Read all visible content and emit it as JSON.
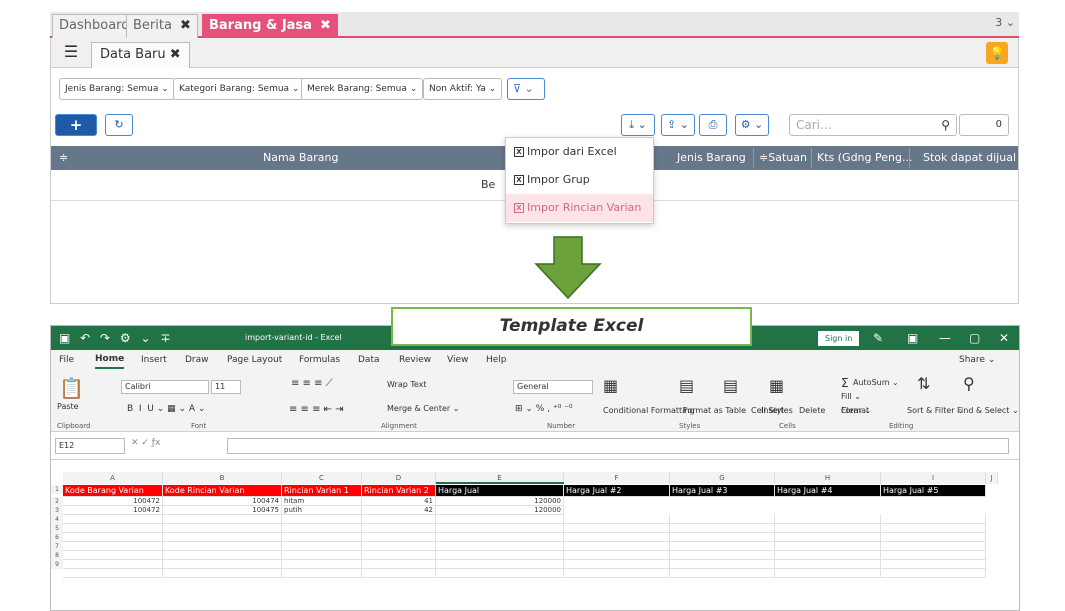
{
  "tabs": [
    {
      "label": "Dashboard"
    },
    {
      "label": "Berita",
      "close": "✖"
    },
    {
      "label": "Barang & Jasa",
      "close": "✖"
    }
  ],
  "tab_count": "3 ⌄",
  "subtab": {
    "label": "Data Baru",
    "close": "✖"
  },
  "filters": [
    "Jenis Barang: Semua ⌄",
    "Kategori Barang: Semua ⌄",
    "Merek Barang: Semua ⌄",
    "Non Aktif: Ya ⌄"
  ],
  "search_placeholder": "Cari...",
  "result_count": "0",
  "table_headers": [
    "Nama Barang",
    "Jenis Barang",
    "≑Satuan",
    "Kts (Gdng Peng...",
    "Stok dapat dijual"
  ],
  "empty_text": "Be",
  "dropdown": [
    {
      "label": "Impor dari Excel"
    },
    {
      "label": "Impor Grup"
    },
    {
      "label": "Impor Rincian Varian"
    }
  ],
  "template_label": "Template Excel",
  "excel": {
    "filename": "import-variant-id - Excel",
    "signin": "Sign in",
    "menu": [
      "File",
      "Home",
      "Insert",
      "Draw",
      "Page Layout",
      "Formulas",
      "Data",
      "Review",
      "View",
      "Help"
    ],
    "share": "Share ⌄",
    "font_name": "Calibri",
    "font_size": "11",
    "number_format": "General",
    "wrap_text": "Wrap Text",
    "merge_center": "Merge & Center ⌄",
    "cf": "Conditional Formatting",
    "fat": "Format as Table",
    "cs": "Cell Styles",
    "insert": "Insert",
    "delete": "Delete",
    "format": "Format",
    "autosum": "AutoSum ⌄",
    "fill": "Fill ⌄",
    "clear": "Clear ⌄",
    "sort": "Sort & Filter ⌄",
    "find": "Find & Select ⌄",
    "groups": [
      "Clipboard",
      "Font",
      "Alignment",
      "Number",
      "Styles",
      "Cells",
      "Editing"
    ],
    "paste": "Paste",
    "name_box": "E12",
    "columns": [
      "A",
      "B",
      "C",
      "D",
      "E",
      "F",
      "G",
      "H",
      "I",
      "J"
    ],
    "headers": [
      "Kode Barang Varian",
      "Kode Rincian Varian",
      "Rincian Varian 1",
      "Rincian Varian 2",
      "Harga Jual",
      "Harga Jual #2",
      "Harga Jual #3",
      "Harga Jual #4",
      "Harga Jual #5"
    ],
    "rows": [
      [
        "100472",
        "100474",
        "hitam",
        "41",
        "120000"
      ],
      [
        "100472",
        "100475",
        "putih",
        "42",
        "120000"
      ]
    ],
    "row_numbers": [
      "1",
      "2",
      "3",
      "4",
      "5",
      "6",
      "7",
      "8",
      "9"
    ]
  },
  "colors": {
    "accent": "#e6507c",
    "primary": "#1f5aa8",
    "excel_green": "#217346",
    "header_red": "#ff0000",
    "header_black": "#000000",
    "arrow_green": "#6ca23c"
  }
}
